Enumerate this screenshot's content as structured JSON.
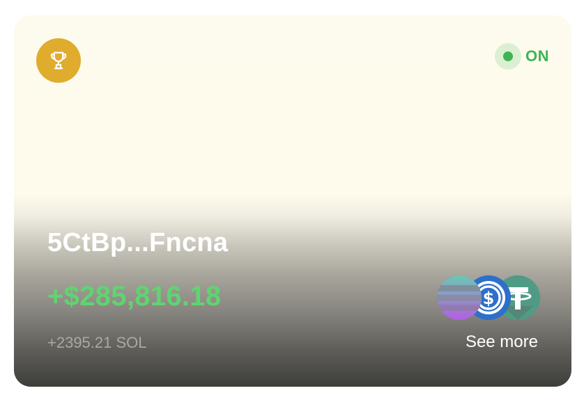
{
  "card": {
    "address": "5CtBp...Fncna",
    "profit": "+$285,816.18",
    "sol_amount": "+2395.21 SOL",
    "see_more_label": "See more",
    "status": {
      "label": "ON",
      "color": "#3fb454"
    },
    "badge": {
      "icon": "trophy-icon",
      "color": "#e0ac2e"
    },
    "tokens": [
      {
        "icon": "solana-icon"
      },
      {
        "icon": "usdc-icon"
      },
      {
        "icon": "tether-icon"
      }
    ]
  }
}
